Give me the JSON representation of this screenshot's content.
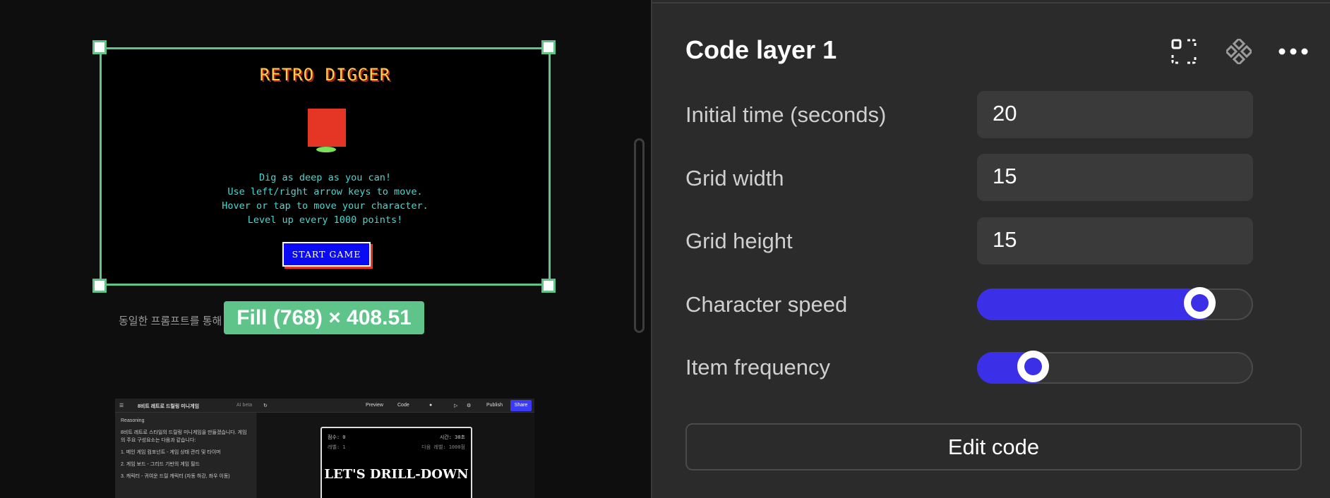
{
  "canvas": {
    "game": {
      "title": "RETRO DIGGER",
      "instructions": [
        "Dig as deep as you can!",
        "Use left/right arrow keys to move.",
        "Hover or tap to move your character.",
        "Level up every 1000 points!"
      ],
      "start_label": "START GAME"
    },
    "caption": "동일한 프롬프트를 통해",
    "size_badge": "Fill (768) × 408.51",
    "thumbnail": {
      "project_name": "8비트 레트로 드릴링 미니게임",
      "ai_badge": "AI beta",
      "preview_label": "Preview",
      "code_label": "Code",
      "publish_label": "Publish",
      "share_label": "Share",
      "reasoning_label": "Reasoning",
      "reasoning_text": "8비트 레트로 스타일의 드릴링 미니게임을 만들겠습니다. 게임의 주요 구성요소는 다음과 같습니다:",
      "steps": [
        "1. 메인 게임 컴포넌트 - 게임 상태 관리 및 타이머",
        "2. 게임 보드 - 그리드 기반의 게임 필드",
        "3. 캐릭터 - 귀여운 드릴 캐릭터 (자동 하강, 좌우 이동)"
      ],
      "score_label": "점수: 0",
      "time_label": "시간: 30초",
      "level_label": "레벨: 1",
      "next_level_label": "다음 레벨: 1000점",
      "mini_title": "LET'S DRILL-DOWN"
    }
  },
  "panel": {
    "title": "Code layer 1",
    "fields": [
      {
        "label": "Initial time (seconds)",
        "value": "20"
      },
      {
        "label": "Grid width",
        "value": "15"
      },
      {
        "label": "Grid height",
        "value": "15"
      }
    ],
    "sliders": [
      {
        "label": "Character speed",
        "level_percent": 81
      },
      {
        "label": "Item frequency",
        "level_percent": 20
      }
    ],
    "edit_label": "Edit code"
  },
  "colors": {
    "accent": "#3b30e8",
    "selection": "#5ec48a"
  }
}
